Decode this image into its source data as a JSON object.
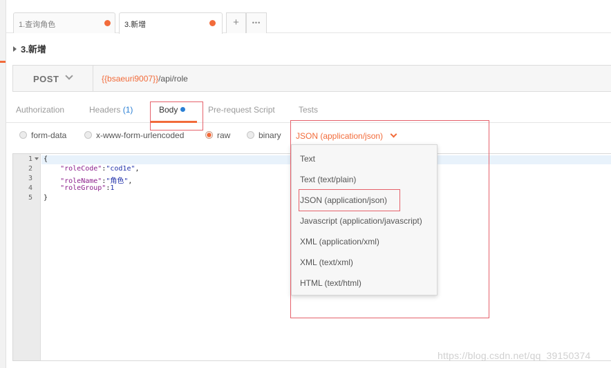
{
  "tabs": [
    {
      "label": "1.查询角色",
      "unsaved": true
    },
    {
      "label": "3.新增",
      "unsaved": true
    }
  ],
  "tab_controls": {
    "add_label": "+",
    "more_label": "•••"
  },
  "request": {
    "title": "3.新增",
    "method": "POST",
    "url_variable": "{{bsaeuri9007}}",
    "url_path": "/api/role"
  },
  "subtabs": {
    "authorization": "Authorization",
    "headers": "Headers",
    "headers_count": "(1)",
    "body": "Body",
    "prerequest": "Pre-request Script",
    "tests": "Tests"
  },
  "body_modes": {
    "form_data": "form-data",
    "urlencoded": "x-www-form-urlencoded",
    "raw": "raw",
    "binary": "binary",
    "selected": "raw"
  },
  "content_type": {
    "selected": "JSON (application/json)",
    "options": [
      "Text",
      "Text (text/plain)",
      "JSON (application/json)",
      "Javascript (application/javascript)",
      "XML (application/xml)",
      "XML (text/xml)",
      "HTML (text/html)"
    ]
  },
  "editor": {
    "line_numbers": [
      "1",
      "2",
      "3",
      "4",
      "5"
    ],
    "lines": {
      "l1": "{",
      "l2_key": "\"roleCode\"",
      "l2_val": "\"cod1e\"",
      "l3_key": "\"roleName\"",
      "l3_val": "\"角色\"",
      "l4_key": "\"roleGroup\"",
      "l4_val": "1",
      "l5": "}"
    }
  },
  "watermark": "https://blog.csdn.net/qq_39150374",
  "colors": {
    "accent": "#f26b3a",
    "highlight": "#e5606a",
    "link": "#2a7fd4"
  }
}
